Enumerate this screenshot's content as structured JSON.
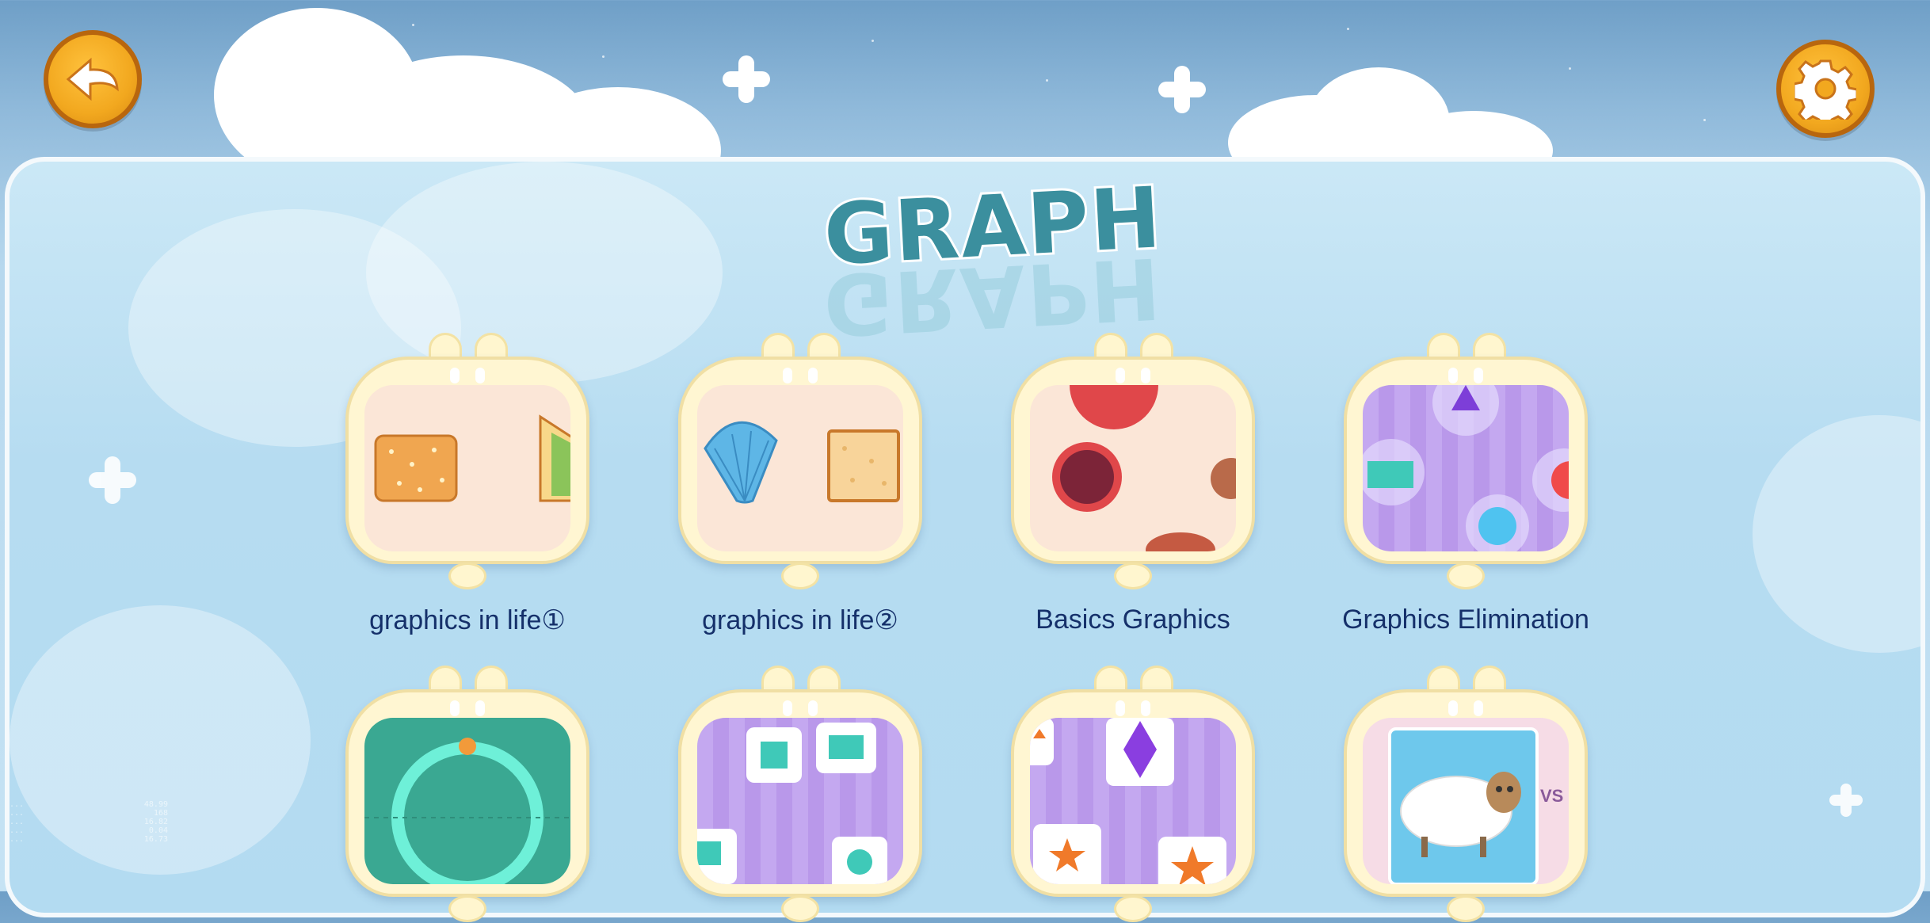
{
  "header": {
    "back_button": {
      "icon": "back-arrow-icon"
    },
    "settings_button": {
      "icon": "gear-icon"
    }
  },
  "title": "GRAPH",
  "levels": [
    {
      "label": "graphics in life①",
      "thumbnail": "bread-sandwich"
    },
    {
      "label": "graphics in life②",
      "thumbnail": "shell-toast"
    },
    {
      "label": "Basics Graphics",
      "thumbnail": "circles"
    },
    {
      "label": "Graphics Elimination",
      "thumbnail": "bubbles"
    },
    {
      "label": "",
      "thumbnail": "ring-track"
    },
    {
      "label": "",
      "thumbnail": "square-tiles"
    },
    {
      "label": "",
      "thumbnail": "diamond-star-tiles"
    },
    {
      "label": "",
      "thumbnail": "sheep-vs"
    }
  ],
  "thumbnail_text": {
    "vs": "VS"
  },
  "debug_overlay": [
    {
      "key": "...",
      "value": "48.99"
    },
    {
      "key": "...",
      "value": "168"
    },
    {
      "key": "...",
      "value": "16.82"
    },
    {
      "key": "...",
      "value": "0.04"
    },
    {
      "key": "...",
      "value": "16.73"
    }
  ],
  "colors": {
    "accent_orange": "#f2a81f",
    "label_navy": "#15306a",
    "title_teal": "#3b8f9e"
  }
}
